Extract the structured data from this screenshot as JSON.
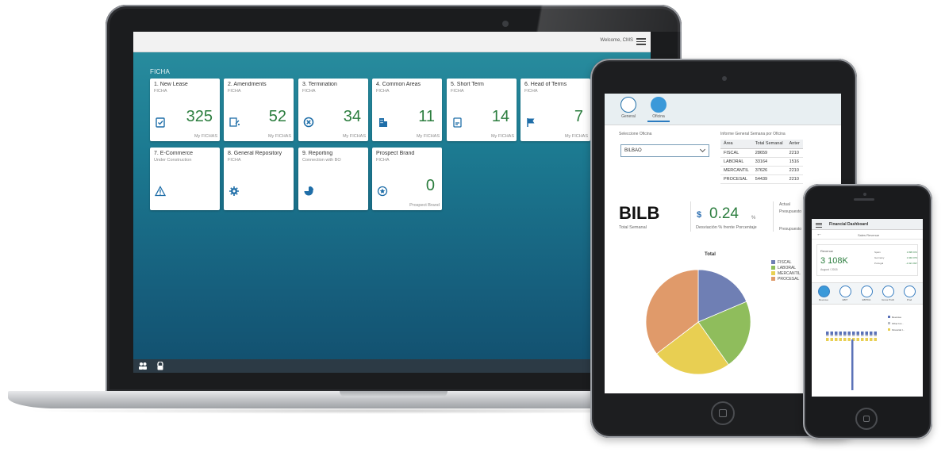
{
  "laptop": {
    "header": {
      "welcome": "Welcome, CMS"
    },
    "group_title": "FICHA",
    "tiles": [
      {
        "title": "1. New Lease",
        "subtitle": "FICHA",
        "number": "325",
        "footer": "My FICHAS",
        "icon": "task-icon"
      },
      {
        "title": "2. Amendments",
        "subtitle": "FICHA",
        "number": "52",
        "footer": "My FICHAS",
        "icon": "edit-document-icon"
      },
      {
        "title": "3. Termination",
        "subtitle": "FICHA",
        "number": "34",
        "footer": "My FICHAS",
        "icon": "cancel-icon"
      },
      {
        "title": "4. Common Areas",
        "subtitle": "FICHA",
        "number": "11",
        "footer": "My FICHAS",
        "icon": "building-icon"
      },
      {
        "title": "5. Short Term",
        "subtitle": "FICHA",
        "number": "14",
        "footer": "My FICHAS",
        "icon": "clipboard-icon"
      },
      {
        "title": "6. Head of Terms",
        "subtitle": "FICHA",
        "number": "7",
        "footer": "My FICHAS",
        "icon": "flag-icon"
      },
      {
        "title": "7. E-Commerce",
        "subtitle": "Under Construction",
        "number": "",
        "footer": "",
        "icon": "warning-icon"
      },
      {
        "title": "8. General Repository",
        "subtitle": "FICHA",
        "number": "",
        "footer": "",
        "icon": "gear-icon"
      },
      {
        "title": "9. Reporting",
        "subtitle": "Connection with BO",
        "number": "",
        "footer": "",
        "icon": "pie-chart-icon"
      },
      {
        "title": "Prospect Brand",
        "subtitle": "FICHA",
        "number": "0",
        "footer": "Prospect Brand",
        "icon": "badge-icon"
      }
    ]
  },
  "tablet": {
    "tabs": [
      {
        "label": "General"
      },
      {
        "label": "Oficina"
      }
    ],
    "select_label": "Seleccione Oficina",
    "select_value": "BILBAO",
    "table_title": "Informe General Semana por Oficina",
    "table_headers": [
      "Área",
      "Total Semanal",
      "Anter"
    ],
    "table_rows": [
      [
        "FISCAL",
        "28659",
        "2210"
      ],
      [
        "LABORAL",
        "33164",
        "1516"
      ],
      [
        "MERCANTIL",
        "37626",
        "2210"
      ],
      [
        "PROCESAL",
        "54439",
        "2210"
      ]
    ],
    "kpi_city": "BILB",
    "kpi_city_label": "Total Semanal",
    "kpi_currency": "$",
    "kpi_deviation": "0.24",
    "kpi_pct": "%",
    "kpi_deviation_label": "Desviación % frente Porcentaje",
    "side_label_1": "Actual",
    "side_label_2": "Presupuesto",
    "side_label_3": "Presupuesto",
    "pie_title": "Total",
    "legend_colors": [
      "#6f7fb4",
      "#8fbd5c",
      "#e8cf52",
      "#e09a6a"
    ]
  },
  "phone": {
    "title": "Financial Dashboard",
    "subtitle": "Sales Revenue",
    "card_label": "Revenue",
    "card_value": "3 108K",
    "card_sub": "August / 2015",
    "card_rows": [
      {
        "label": "Spain",
        "value": "1 895 972"
      },
      {
        "label": "Germany",
        "value": "1 940 073"
      },
      {
        "label": "Portugal",
        "value": "-1 021 997"
      }
    ],
    "icon_tabs": [
      {
        "label": "Revenue"
      },
      {
        "label": "EBIT"
      },
      {
        "label": "EBITDA"
      },
      {
        "label": "Gross Profit"
      },
      {
        "label": "Prod"
      }
    ],
    "legend": [
      {
        "label": "Revenue",
        "color": "#5b72b8"
      },
      {
        "label": "Other Inc...",
        "color": "#b8bcc4"
      },
      {
        "label": "Financial I...",
        "color": "#e8cf52"
      }
    ]
  },
  "chart_data": [
    {
      "type": "pie",
      "title": "Total",
      "categories": [
        "FISCAL",
        "LABORAL",
        "MERCANTIL",
        "PROCESAL"
      ],
      "values": [
        28659,
        33164,
        37626,
        54439
      ],
      "colors": [
        "#6f7fb4",
        "#8fbd5c",
        "#e8cf52",
        "#e09a6a"
      ],
      "legend": "right"
    }
  ]
}
